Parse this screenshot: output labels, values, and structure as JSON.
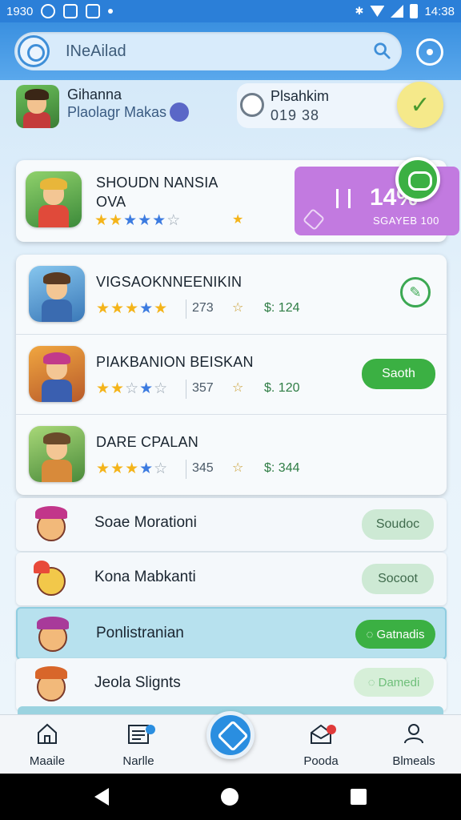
{
  "status_bar": {
    "time": "1930",
    "clock": "14:38"
  },
  "search": {
    "placeholder": "INeAilad"
  },
  "profile": {
    "name": "Gihanna",
    "subtitle": "Plaolagr Makas",
    "card_title": "Plsahkim",
    "card_value": "019 38"
  },
  "featured": {
    "title": "SHOUDN NANSIA",
    "subtitle": "OVA",
    "rating": 3.5,
    "promo_value": "14%",
    "promo_caption": "SGAYEB 100"
  },
  "games": [
    {
      "title": "VIGSAOKNNEENIKIN",
      "rating": 4,
      "count": "273",
      "price": "$: 124",
      "action": ""
    },
    {
      "title": "PIAKBANION BEISKAN",
      "rating": 3,
      "count": "357",
      "price": "$. 120",
      "action": "Saoth"
    },
    {
      "title": "DARE CPALAN",
      "rating": 3.5,
      "count": "345",
      "price": "$: 344",
      "action": ""
    }
  ],
  "friends": [
    {
      "name": "Soae Morationi",
      "action": "Soudoc"
    },
    {
      "name": "Kona Mabkanti",
      "action": "Socoot"
    },
    {
      "name": "Ponlistranian",
      "action": "Gatnadis"
    },
    {
      "name": "Jeola Slignts",
      "action": "Damedi"
    }
  ],
  "nav": {
    "items": [
      {
        "label": "Maaile"
      },
      {
        "label": "Narlle"
      },
      {
        "label": "Pooda"
      },
      {
        "label": "Blmeals"
      }
    ]
  },
  "colors": {
    "status_bar": "#2b7fd8",
    "accent_green": "#3bb043",
    "promo_purple": "#c27ae0",
    "fab_blue": "#2a8ee0"
  }
}
